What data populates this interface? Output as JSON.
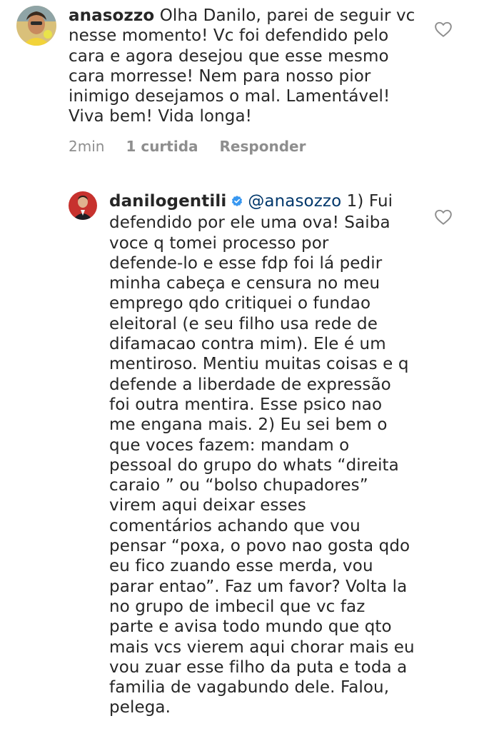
{
  "comments": [
    {
      "username": "anasozzo",
      "text": " Olha Danilo, parei de seguir vc\nnesse momento! Vc foi defendido pelo\ncara e agora desejou que esse mesmo\ncara morresse! Nem para nosso pior\ninimigo desejamos o mal. Lamentável!\nViva bem! Vida longa!",
      "time": "2min",
      "likes": "1 curtida",
      "reply_label": "Responder",
      "like_icon": "heart-outline-icon"
    },
    {
      "username": "danilogentili",
      "verified": true,
      "verified_icon": "verified-badge-icon",
      "mention": "@anasozzo",
      "text": " 1) Fui\ndefendido por ele uma ova! Saiba\nvoce q tomei processo por\ndefende-lo e esse fdp foi lá pedir\nminha cabeça e censura no meu\nemprego qdo critiquei o fundao\neleitoral (e seu filho usa rede de\ndifamacao contra mim). Ele é um\nmentiroso. Mentiu muitas coisas e q\ndefende a liberdade de expressão\nfoi outra mentira. Esse psico nao\nme engana mais. 2) Eu sei bem o\nque voces fazem: mandam o\npessoal do grupo do whats “direita\ncaraio ” ou “bolso chupadores”\nvirem aqui deixar esses\ncomentários achando que vou\npensar “poxa, o povo nao gosta qdo\neu fico zuando esse merda, vou\nparar entao”. Faz um favor? Volta la\nno grupo de imbecil que vc faz\nparte e avisa todo mundo que qto\nmais vcs vierem aqui chorar mais eu\nvou zuar esse filho da puta e toda a\nfamilia de vagabundo dele. Falou,\npelega.",
      "like_icon": "heart-outline-icon"
    }
  ],
  "colors": {
    "text": "#262626",
    "muted": "#8e8e8e",
    "mention": "#00376b",
    "verified": "#3897f0"
  }
}
